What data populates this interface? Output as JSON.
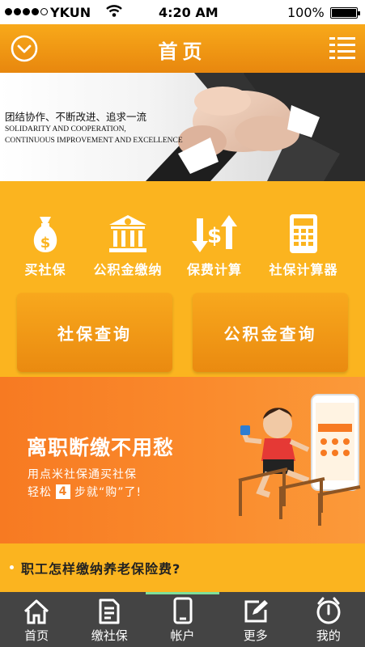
{
  "status_bar": {
    "carrier": "YKUN",
    "time": "4:20 AM",
    "battery": "100%"
  },
  "nav": {
    "title": "首页",
    "left_icon": "chevron-down-circle-icon",
    "right_icon": "menu-list-icon"
  },
  "banner": {
    "slogan_cn": "团结协作、不断改进、追求一流",
    "slogan_en_line1": "SOLIDARITY AND COOPERATION,",
    "slogan_en_line2": "CONTINUOUS IMPROVEMENT AND EXCELLENCE"
  },
  "services": [
    {
      "label": "买社保",
      "icon": "money-bag-icon"
    },
    {
      "label": "公积金缴纳",
      "icon": "bank-icon"
    },
    {
      "label": "保费计算",
      "icon": "exchange-icon"
    },
    {
      "label": "社保计算器",
      "icon": "calculator-icon"
    }
  ],
  "queries": {
    "social": "社保查询",
    "fund": "公积金查询"
  },
  "promo": {
    "headline": "离职断缴不用愁",
    "line1": "用点米社保通买社保",
    "line2_prefix": "轻松",
    "line2_step": "4",
    "line2_suffix": "步就“购”了!"
  },
  "article": {
    "title": "职工怎样缴纳养老保险费?"
  },
  "tabs": [
    {
      "label": "首页",
      "icon": "home-icon"
    },
    {
      "label": "缴社保",
      "icon": "document-icon"
    },
    {
      "label": "帐户",
      "icon": "phone-icon"
    },
    {
      "label": "更多",
      "icon": "edit-icon"
    },
    {
      "label": "我的",
      "icon": "clock-icon"
    }
  ],
  "colors": {
    "primary": "#f8a91a",
    "section": "#fbb41f",
    "promo": "#f77a22",
    "tab_bar": "#444444",
    "tab_active": "#7ee09a"
  }
}
